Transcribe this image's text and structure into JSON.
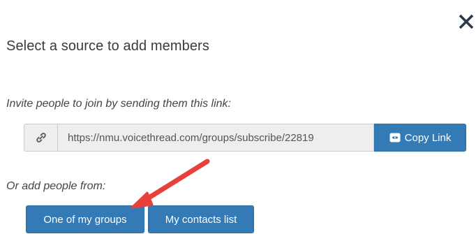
{
  "dialog": {
    "title": "Select a source to add members",
    "close_icon": "close-icon"
  },
  "invite": {
    "label": "Invite people to join by sending them this link:",
    "link_icon": "link-icon",
    "url": "https://nmu.voicethread.com/groups/subscribe/22819",
    "copy_button_label": "Copy Link",
    "copy_icon": "copy-link-icon",
    "copy_button_color": "#337ab7"
  },
  "add_from": {
    "label": "Or add people from:",
    "groups_button_label": "One of my groups",
    "contacts_button_label": "My contacts list"
  },
  "annotation": {
    "arrow_color": "#e8403a"
  }
}
